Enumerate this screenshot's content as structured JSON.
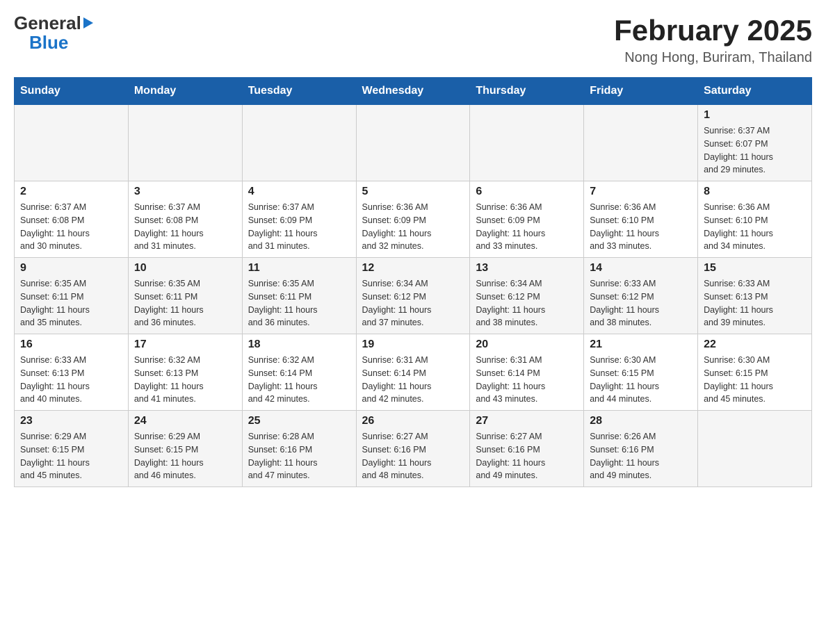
{
  "logo": {
    "general": "General",
    "triangle": "▶",
    "blue": "Blue"
  },
  "header": {
    "title": "February 2025",
    "subtitle": "Nong Hong, Buriram, Thailand"
  },
  "weekdays": [
    "Sunday",
    "Monday",
    "Tuesday",
    "Wednesday",
    "Thursday",
    "Friday",
    "Saturday"
  ],
  "weeks": [
    {
      "days": [
        {
          "num": "",
          "info": ""
        },
        {
          "num": "",
          "info": ""
        },
        {
          "num": "",
          "info": ""
        },
        {
          "num": "",
          "info": ""
        },
        {
          "num": "",
          "info": ""
        },
        {
          "num": "",
          "info": ""
        },
        {
          "num": "1",
          "info": "Sunrise: 6:37 AM\nSunset: 6:07 PM\nDaylight: 11 hours\nand 29 minutes."
        }
      ]
    },
    {
      "days": [
        {
          "num": "2",
          "info": "Sunrise: 6:37 AM\nSunset: 6:08 PM\nDaylight: 11 hours\nand 30 minutes."
        },
        {
          "num": "3",
          "info": "Sunrise: 6:37 AM\nSunset: 6:08 PM\nDaylight: 11 hours\nand 31 minutes."
        },
        {
          "num": "4",
          "info": "Sunrise: 6:37 AM\nSunset: 6:09 PM\nDaylight: 11 hours\nand 31 minutes."
        },
        {
          "num": "5",
          "info": "Sunrise: 6:36 AM\nSunset: 6:09 PM\nDaylight: 11 hours\nand 32 minutes."
        },
        {
          "num": "6",
          "info": "Sunrise: 6:36 AM\nSunset: 6:09 PM\nDaylight: 11 hours\nand 33 minutes."
        },
        {
          "num": "7",
          "info": "Sunrise: 6:36 AM\nSunset: 6:10 PM\nDaylight: 11 hours\nand 33 minutes."
        },
        {
          "num": "8",
          "info": "Sunrise: 6:36 AM\nSunset: 6:10 PM\nDaylight: 11 hours\nand 34 minutes."
        }
      ]
    },
    {
      "days": [
        {
          "num": "9",
          "info": "Sunrise: 6:35 AM\nSunset: 6:11 PM\nDaylight: 11 hours\nand 35 minutes."
        },
        {
          "num": "10",
          "info": "Sunrise: 6:35 AM\nSunset: 6:11 PM\nDaylight: 11 hours\nand 36 minutes."
        },
        {
          "num": "11",
          "info": "Sunrise: 6:35 AM\nSunset: 6:11 PM\nDaylight: 11 hours\nand 36 minutes."
        },
        {
          "num": "12",
          "info": "Sunrise: 6:34 AM\nSunset: 6:12 PM\nDaylight: 11 hours\nand 37 minutes."
        },
        {
          "num": "13",
          "info": "Sunrise: 6:34 AM\nSunset: 6:12 PM\nDaylight: 11 hours\nand 38 minutes."
        },
        {
          "num": "14",
          "info": "Sunrise: 6:33 AM\nSunset: 6:12 PM\nDaylight: 11 hours\nand 38 minutes."
        },
        {
          "num": "15",
          "info": "Sunrise: 6:33 AM\nSunset: 6:13 PM\nDaylight: 11 hours\nand 39 minutes."
        }
      ]
    },
    {
      "days": [
        {
          "num": "16",
          "info": "Sunrise: 6:33 AM\nSunset: 6:13 PM\nDaylight: 11 hours\nand 40 minutes."
        },
        {
          "num": "17",
          "info": "Sunrise: 6:32 AM\nSunset: 6:13 PM\nDaylight: 11 hours\nand 41 minutes."
        },
        {
          "num": "18",
          "info": "Sunrise: 6:32 AM\nSunset: 6:14 PM\nDaylight: 11 hours\nand 42 minutes."
        },
        {
          "num": "19",
          "info": "Sunrise: 6:31 AM\nSunset: 6:14 PM\nDaylight: 11 hours\nand 42 minutes."
        },
        {
          "num": "20",
          "info": "Sunrise: 6:31 AM\nSunset: 6:14 PM\nDaylight: 11 hours\nand 43 minutes."
        },
        {
          "num": "21",
          "info": "Sunrise: 6:30 AM\nSunset: 6:15 PM\nDaylight: 11 hours\nand 44 minutes."
        },
        {
          "num": "22",
          "info": "Sunrise: 6:30 AM\nSunset: 6:15 PM\nDaylight: 11 hours\nand 45 minutes."
        }
      ]
    },
    {
      "days": [
        {
          "num": "23",
          "info": "Sunrise: 6:29 AM\nSunset: 6:15 PM\nDaylight: 11 hours\nand 45 minutes."
        },
        {
          "num": "24",
          "info": "Sunrise: 6:29 AM\nSunset: 6:15 PM\nDaylight: 11 hours\nand 46 minutes."
        },
        {
          "num": "25",
          "info": "Sunrise: 6:28 AM\nSunset: 6:16 PM\nDaylight: 11 hours\nand 47 minutes."
        },
        {
          "num": "26",
          "info": "Sunrise: 6:27 AM\nSunset: 6:16 PM\nDaylight: 11 hours\nand 48 minutes."
        },
        {
          "num": "27",
          "info": "Sunrise: 6:27 AM\nSunset: 6:16 PM\nDaylight: 11 hours\nand 49 minutes."
        },
        {
          "num": "28",
          "info": "Sunrise: 6:26 AM\nSunset: 6:16 PM\nDaylight: 11 hours\nand 49 minutes."
        },
        {
          "num": "",
          "info": ""
        }
      ]
    }
  ]
}
